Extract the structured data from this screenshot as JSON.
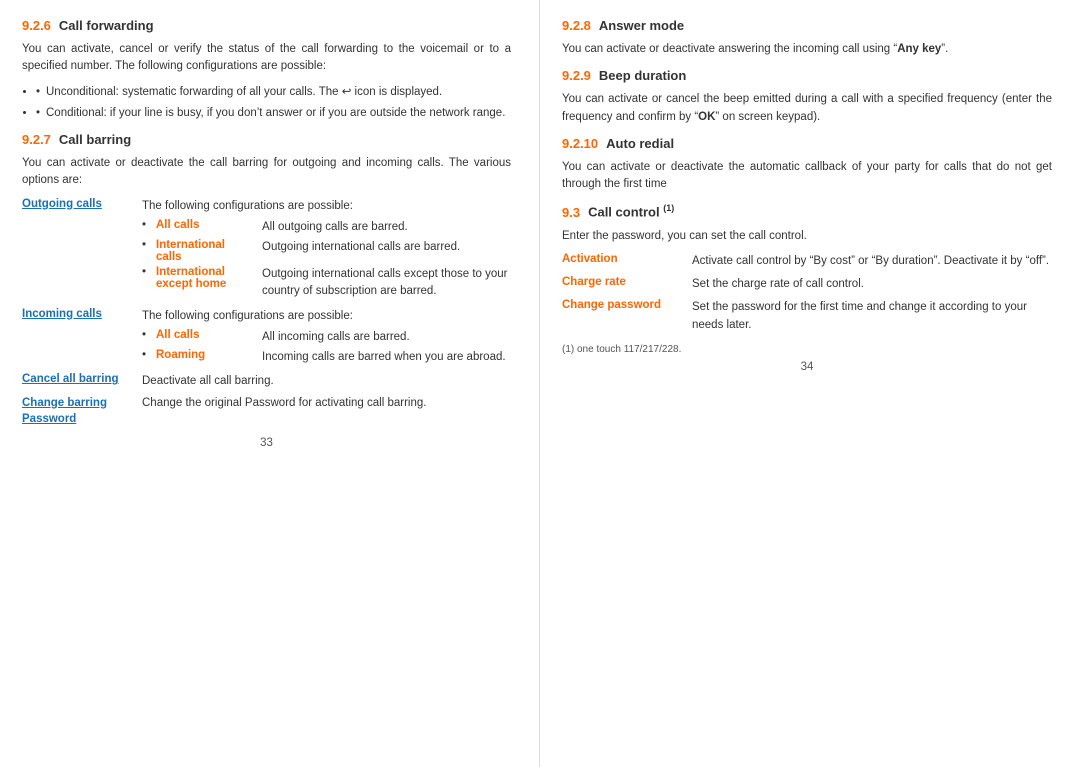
{
  "left_page": {
    "page_number": "33",
    "section_926": {
      "num": "9.2.6",
      "title": "Call forwarding",
      "body": "You can activate, cancel or verify the status of the call forwarding to the voicemail or to a specified number. The following configurations are possible:",
      "bullets": [
        "Unconditional: systematic forwarding of all your calls. The ↪ icon is displayed.",
        "Conditional: if your line is busy, if you don’t answer or if you are outside the network range."
      ]
    },
    "section_927": {
      "num": "9.2.7",
      "title": "Call barring",
      "body": "You can activate or deactivate the call barring for outgoing and incoming calls. The various options are:",
      "outgoing_calls_label": "Outgoing calls",
      "outgoing_calls_desc": "The following configurations are possible:",
      "outgoing_sub": [
        {
          "label": "All calls",
          "desc": "All outgoing calls are barred."
        },
        {
          "label": "International calls",
          "desc": "Outgoing international calls are barred."
        },
        {
          "label": "International except home",
          "desc": "Outgoing international calls except those to your country of subscription are barred."
        }
      ],
      "incoming_calls_label": "Incoming calls",
      "incoming_calls_desc": "The following configurations are possible:",
      "incoming_sub": [
        {
          "label": "All calls",
          "desc": "All incoming calls are barred."
        },
        {
          "label": "Roaming",
          "desc": "Incoming calls are barred when you are abroad."
        }
      ],
      "cancel_label": "Cancel all barring",
      "cancel_desc": "Deactivate all call barring.",
      "change_label": "Change barring Password",
      "change_desc": "Change the original Password for activating call barring."
    }
  },
  "right_page": {
    "page_number": "34",
    "section_928": {
      "num": "9.2.8",
      "title": "Answer mode",
      "body_before": "You can activate or deactivate answering the incoming call using \"",
      "bold_text": "Any key",
      "body_after": "\"."
    },
    "section_929": {
      "num": "9.2.9",
      "title": "Beep duration",
      "body": "You can activate or cancel the beep emitted during a call with a specified frequency (enter the frequency and confirm by \"OK\" on screen keypad)."
    },
    "section_9210": {
      "num": "9.2.10",
      "title": "Auto redial",
      "body": "You can activate or deactivate the automatic callback of your party for calls that do not get through the first time"
    },
    "section_93": {
      "num": "9.3",
      "title": "Call control",
      "superscript": "(1)",
      "body": "Enter the password, you can set the call control.",
      "items": [
        {
          "label": "Activation",
          "desc": "Activate call control by \"By cost\" or \"By duration\". Deactivate it by \"off\"."
        },
        {
          "label": "Charge rate",
          "desc": "Set the charge rate of call control."
        },
        {
          "label": "Change password",
          "desc": "Set the password for the first time and change it according to your needs later."
        }
      ],
      "footnote": "(1)   one touch 117/217/228."
    }
  }
}
